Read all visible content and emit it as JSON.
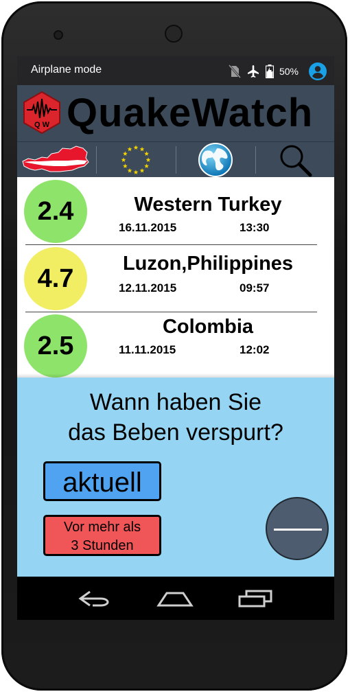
{
  "status_bar": {
    "mode_text": "Airplane mode",
    "battery_percent": "50%",
    "icons": [
      "no-sim-icon",
      "airplane-icon",
      "battery-icon",
      "account-icon"
    ]
  },
  "app": {
    "title": "QuakeWatch",
    "logo_text": "Q W",
    "colors": {
      "bar": "#3c4a5a",
      "logo": "#d9252b"
    }
  },
  "nav": {
    "icons": [
      "austria-map-icon",
      "eu-flag-icon",
      "globe-icon",
      "search-icon"
    ]
  },
  "quakes": [
    {
      "magnitude": "2.4",
      "region": "Western Turkey",
      "date": "16.11.2015",
      "time": "13:30",
      "color": "#8ee46a"
    },
    {
      "magnitude": "4.7",
      "region": "Luzon,Philippines",
      "date": "12.11.2015",
      "time": "09:57",
      "color": "#f1ee64"
    },
    {
      "magnitude": "2.5",
      "region": "Colombia",
      "date": "11.11.2015",
      "time": "12:02",
      "color": "#8ee46a"
    }
  ],
  "popup": {
    "question_line1": "Wann haben Sie",
    "question_line2": "das Beben verspurt?",
    "now_button": "aktuell",
    "older_button_line1": "Vor mehr als",
    "older_button_line2": "3 Stunden",
    "colors": {
      "background": "#95d5f3",
      "now": "#4fa3f0",
      "older": "#f05558"
    }
  },
  "system_nav": {
    "icons": [
      "back-icon",
      "home-icon",
      "recents-icon"
    ]
  }
}
